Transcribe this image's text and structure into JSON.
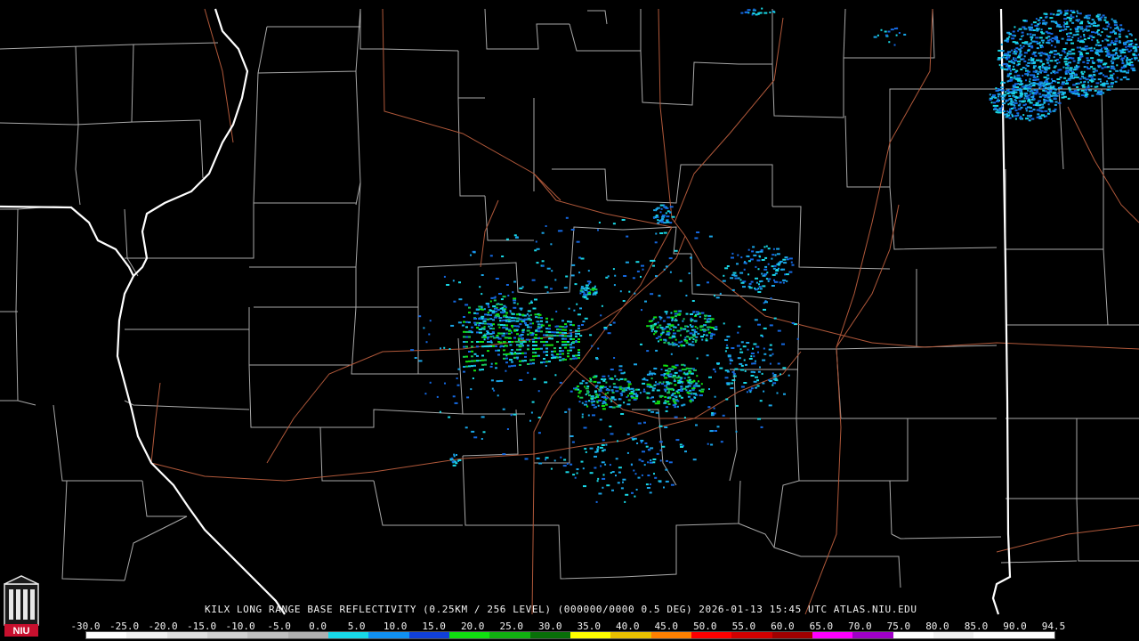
{
  "product": {
    "station": "KILX",
    "product_name": "LONG RANGE BASE REFLECTIVITY",
    "resolution": "(0.25KM / 256 LEVEL)",
    "scan_info": "(000000/0000 0.5 DEG)",
    "timestamp": "2026-01-13 15:45 UTC",
    "source": "ATLAS.NIU.EDU"
  },
  "scale": {
    "labels": [
      "-30.0",
      "-25.0",
      "-20.0",
      "-15.0",
      "-10.0",
      "-5.0",
      "0.0",
      "5.0",
      "10.0",
      "15.0",
      "20.0",
      "25.0",
      "30.0",
      "35.0",
      "40.0",
      "45.0",
      "50.0",
      "55.0",
      "60.0",
      "65.0",
      "70.0",
      "75.0",
      "80.0",
      "85.0",
      "90.0",
      "94.5"
    ],
    "colors": [
      "#ffffff",
      "#f0f0f0",
      "#e0e0e0",
      "#d0d0d0",
      "#c0c0c0",
      "#b0b0b0",
      "#18d8e8",
      "#1090f0",
      "#1040d8",
      "#10e010",
      "#10b010",
      "#087008",
      "#ffff00",
      "#e8c000",
      "#ff8000",
      "#ff0000",
      "#d00000",
      "#a00000",
      "#ff00ff",
      "#a000c8",
      "#ffffff",
      "#f0f0f0",
      "#ffffff",
      "#ffffff"
    ]
  },
  "logo": {
    "label": "NIU",
    "icon": "university-tower-icon",
    "color": "#c8102e"
  },
  "map": {
    "background": "#000000",
    "county_line_color": "#a8a8a8",
    "state_line_color": "#ffffff",
    "highway_color": "#b0583a",
    "echo_colors": [
      "#1aa6e8",
      "#19d8e6",
      "#1568e0",
      "#16c45a",
      "#10e010",
      "#c8d800"
    ]
  }
}
